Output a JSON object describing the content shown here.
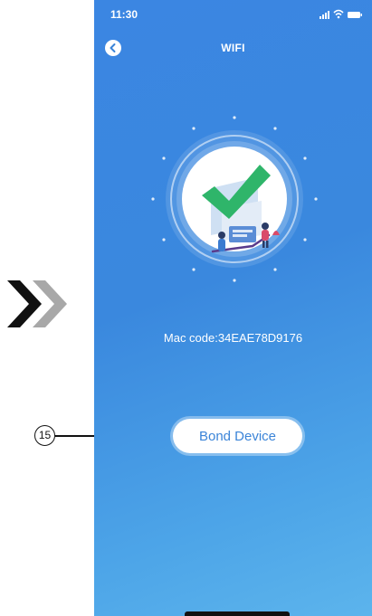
{
  "status": {
    "time": "11:30"
  },
  "header": {
    "title": "WIFI"
  },
  "main": {
    "mac_code": "Mac code:34EAE78D9176",
    "bond_button": "Bond Device"
  },
  "callout": {
    "number": "15"
  },
  "colors": {
    "background_gradient_start": "#3b86e2",
    "background_gradient_end": "#5cb4ec",
    "check_green": "#2fb56a",
    "button_text": "#3b84d8"
  },
  "icons": [
    "back-arrow-icon",
    "signal-icon",
    "wifi-icon",
    "battery-icon",
    "success-check-icon",
    "double-chevron-icon"
  ]
}
